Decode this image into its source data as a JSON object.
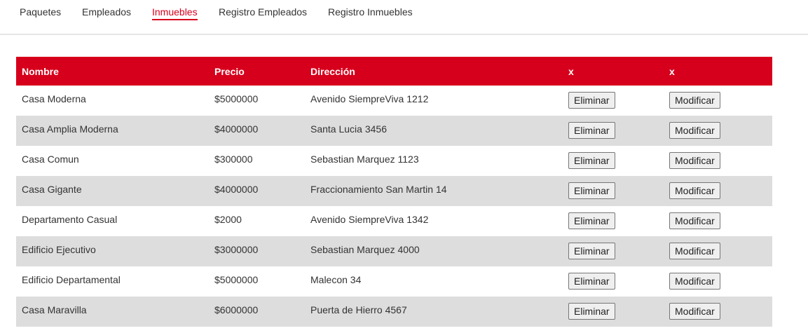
{
  "nav": {
    "items": [
      {
        "label": "Paquetes",
        "active": false
      },
      {
        "label": "Empleados",
        "active": false
      },
      {
        "label": "Inmuebles",
        "active": true
      },
      {
        "label": "Registro Empleados",
        "active": false
      },
      {
        "label": "Registro Inmuebles",
        "active": false
      }
    ]
  },
  "colors": {
    "accent": "#d6001c",
    "row_alt": "#dddddd"
  },
  "table": {
    "headers": [
      "Nombre",
      "Precio",
      "Dirección",
      "x",
      "x"
    ],
    "delete_label": "Eliminar",
    "modify_label": "Modificar",
    "rows": [
      {
        "nombre": "Casa Moderna",
        "precio": "$5000000",
        "direccion": "Avenido SiempreViva 1212"
      },
      {
        "nombre": "Casa Amplia Moderna",
        "precio": "$4000000",
        "direccion": "Santa Lucia 3456"
      },
      {
        "nombre": "Casa Comun",
        "precio": "$300000",
        "direccion": "Sebastian Marquez 1123"
      },
      {
        "nombre": "Casa Gigante",
        "precio": "$4000000",
        "direccion": "Fraccionamiento San Martin 14"
      },
      {
        "nombre": "Departamento Casual",
        "precio": "$2000",
        "direccion": "Avenido SiempreViva 1342"
      },
      {
        "nombre": "Edificio Ejecutivo",
        "precio": "$3000000",
        "direccion": "Sebastian Marquez 4000"
      },
      {
        "nombre": "Edificio Departamental",
        "precio": "$5000000",
        "direccion": "Malecon 34"
      },
      {
        "nombre": "Casa Maravilla",
        "precio": "$6000000",
        "direccion": "Puerta de Hierro 4567"
      }
    ]
  }
}
